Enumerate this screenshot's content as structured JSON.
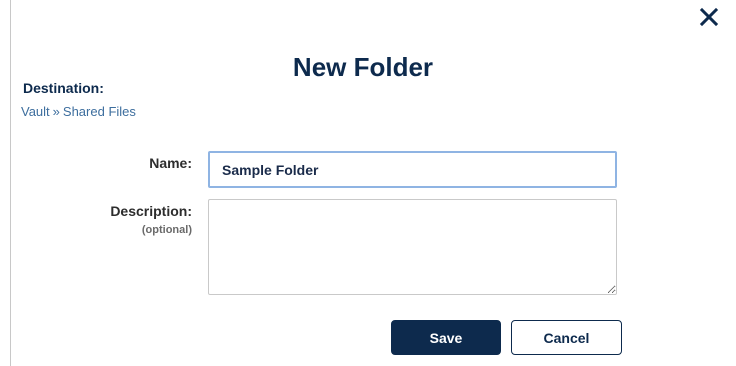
{
  "dialog": {
    "title": "New Folder",
    "close_icon": "close-icon"
  },
  "destination": {
    "label": "Destination:",
    "path": [
      "Vault",
      "Shared Files"
    ],
    "separator": "»"
  },
  "form": {
    "name_label": "Name:",
    "name_value": "Sample Folder",
    "description_label": "Description:",
    "description_hint": "(optional)",
    "description_value": ""
  },
  "actions": {
    "save_label": "Save",
    "cancel_label": "Cancel"
  },
  "colors": {
    "primary": "#0d2a4d",
    "link": "#3d6e9e",
    "focus_border": "#8fb4e3"
  }
}
